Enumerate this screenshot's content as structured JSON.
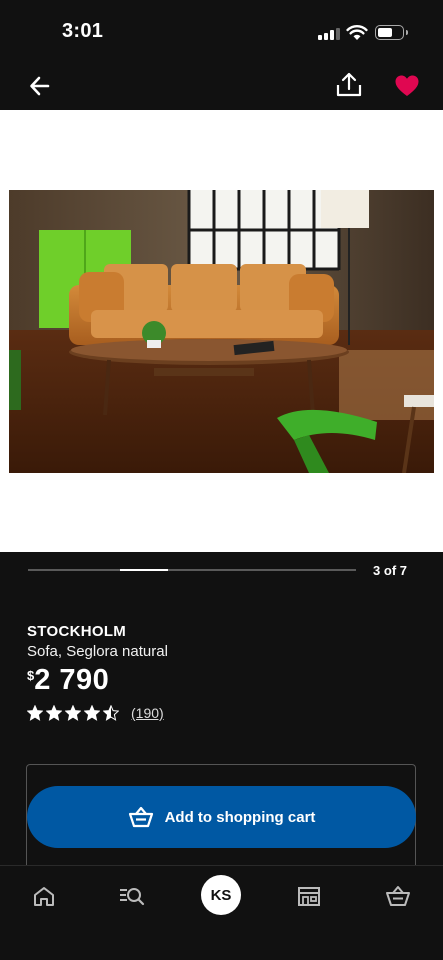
{
  "status_bar": {
    "time": "3:01",
    "battery_level": 0.6
  },
  "nav": {
    "back_icon": "arrow-left-icon",
    "share_icon": "share-icon",
    "favorite_icon": "heart-icon",
    "favorite_color": "#e00751"
  },
  "gallery": {
    "counter": "3 of 7",
    "current": 3,
    "total": 7
  },
  "product": {
    "name": "STOCKHOLM",
    "description": "Sofa, Seglora natural",
    "price_currency": "$",
    "price_amount": "2 790",
    "rating": 4.5,
    "rating_max": 5,
    "review_count": "(190)"
  },
  "cart": {
    "add_label": "Add to shopping cart",
    "button_color": "#0058a3"
  },
  "tab_bar": {
    "home_icon": "home-icon",
    "search_icon": "search-list-icon",
    "profile_initials": "KS",
    "store_icon": "store-icon",
    "cart_icon": "shopping-basket-icon"
  }
}
